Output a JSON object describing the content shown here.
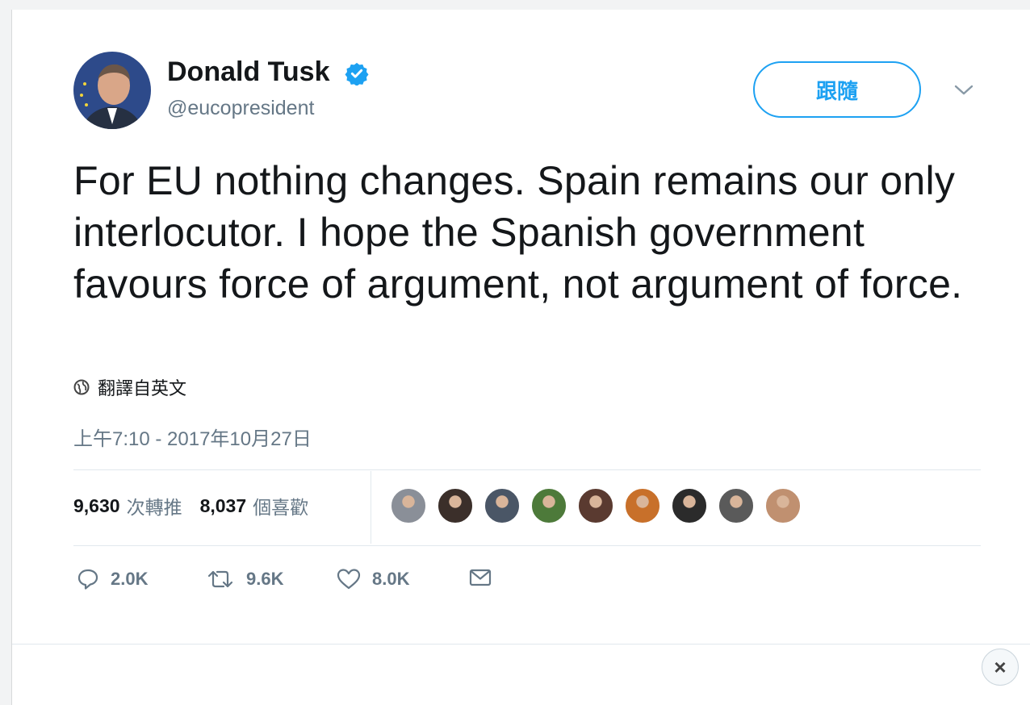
{
  "tweet": {
    "author": {
      "display_name": "Donald Tusk",
      "handle": "@eucopresident",
      "verified": true
    },
    "follow_button": {
      "label": "跟隨"
    },
    "text": "For EU nothing changes. Spain remains our only interlocutor. I hope the Spanish government favours force of argument, not argument of force.",
    "translate": {
      "icon": "globe-icon",
      "label": "翻譯自英文"
    },
    "timestamp": "上午7:10 - 2017年10月27日",
    "stats": {
      "retweets": {
        "count": "9,630",
        "label": "次轉推"
      },
      "likes": {
        "count": "8,037",
        "label": "個喜歡"
      }
    },
    "liker_avatar_colors": [
      "#8a8f98",
      "#3b2f2a",
      "#4a5666",
      "#4d7a3a",
      "#5a3a30",
      "#c8702a",
      "#2b2b2b",
      "#5a5a5a",
      "#c09070"
    ],
    "actions": {
      "reply": {
        "icon": "reply-icon",
        "count": "2.0K"
      },
      "retweet": {
        "icon": "retweet-icon",
        "count": "9.6K"
      },
      "like": {
        "icon": "heart-icon",
        "count": "8.0K"
      },
      "message": {
        "icon": "envelope-icon"
      }
    },
    "close_button": {
      "icon": "close-icon",
      "label": "×"
    }
  },
  "colors": {
    "accent": "#1da1f2",
    "secondary_text": "#657786",
    "divider": "#e1e8ed"
  }
}
